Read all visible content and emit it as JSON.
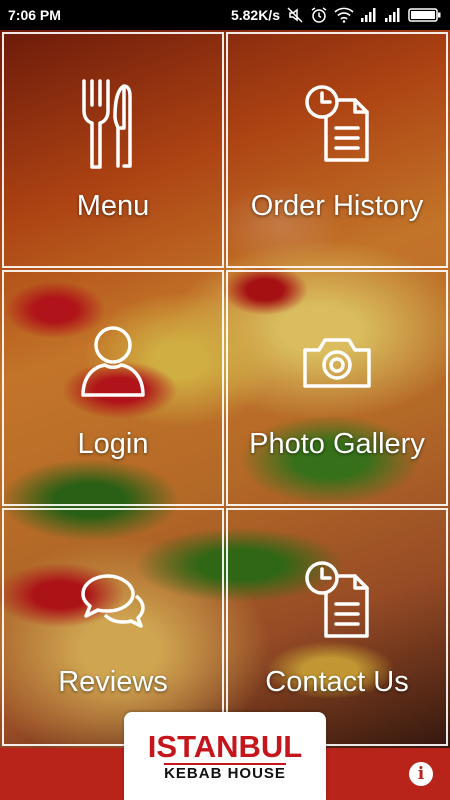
{
  "status_bar": {
    "time": "7:06 PM",
    "network_speed": "5.82K/s",
    "icons": [
      "mute-icon",
      "alarm-icon",
      "wifi-icon",
      "signal-icon",
      "signal-icon",
      "battery-icon"
    ]
  },
  "tiles": [
    {
      "label": "Menu",
      "icon": "fork-knife-icon"
    },
    {
      "label": "Order History",
      "icon": "order-history-icon"
    },
    {
      "label": "Login",
      "icon": "user-icon"
    },
    {
      "label": "Photo Gallery",
      "icon": "camera-icon"
    },
    {
      "label": "Reviews",
      "icon": "chat-bubbles-icon"
    },
    {
      "label": "Contact Us",
      "icon": "contact-icon"
    }
  ],
  "logo": {
    "main": "ISTANBUL",
    "sub": "KEBAB HOUSE"
  },
  "footer": {
    "info_icon": "i"
  },
  "colors": {
    "brand_red": "#b8231a",
    "logo_red": "#c4161c",
    "tile_border": "#ffffff"
  }
}
